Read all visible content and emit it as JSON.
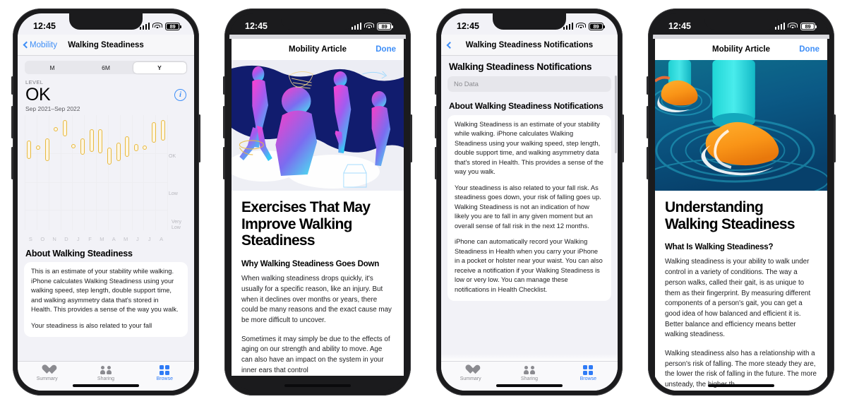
{
  "status_bar": {
    "time": "12:45",
    "battery": "89",
    "signal_icon": "cellular-bars-icon",
    "wifi_icon": "wifi-icon",
    "battery_icon": "battery-icon"
  },
  "phones": [
    {
      "id": "walking-steadiness-detail",
      "nav": {
        "back_label": "Mobility",
        "title": "Walking Steadiness"
      },
      "segmented": {
        "options": [
          "M",
          "6M",
          "Y"
        ],
        "selected": "Y"
      },
      "level_label": "LEVEL",
      "level_value": "OK",
      "info_icon": "info-circle-icon",
      "date_range": "Sep 2021–Sep 2022",
      "about_title": "About Walking Steadiness",
      "about_paragraphs": [
        "This is an estimate of your stability while walking. iPhone calculates Walking Steadiness using your walking speed, step length, double support time, and walking asymmetry data that's stored in Health. This provides a sense of the way you walk.",
        "Your steadiness is also related to your fall"
      ]
    },
    {
      "id": "exercises-article",
      "nav": {
        "title": "Mobility Article",
        "done_label": "Done"
      },
      "hero_alt": "walking-figures-illustration",
      "title": "Exercises That May Improve Walking Steadiness",
      "subhead": "Why Walking Steadiness Goes Down",
      "paragraphs": [
        "When walking steadiness drops quickly, it's usually for a specific reason, like an injury. But when it declines over months or years, there could be many reasons and the exact cause may be more difficult to uncover.",
        "Sometimes it may simply be due to the effects of aging on our strength and ability to move. Age can also have an impact on the system in your inner ears that control"
      ]
    },
    {
      "id": "notifications-settings",
      "nav": {
        "title": "Walking Steadiness Notifications"
      },
      "page_heading": "Walking Steadiness Notifications",
      "nodata_value": "No Data",
      "about_title": "About Walking Steadiness Notifications",
      "paragraphs": [
        "Walking Steadiness is an estimate of your stability while walking. iPhone calculates Walking Steadiness using your walking speed, step length, double support time, and walking asymmetry data that's stored in Health. This provides a sense of the way you walk.",
        "Your steadiness is also related to your fall risk. As steadiness goes down, your risk of falling goes up. Walking Steadiness is not an indication of how likely you are to fall in any given moment but an overall sense of fall risk in the next 12 months.",
        "iPhone can automatically record your Walking Steadiness in Health when you carry your iPhone in a pocket or holster near your waist. You can also receive a notification if your Walking Steadiness is low or very low. You can manage these notifications in Health Checklist."
      ]
    },
    {
      "id": "understanding-article",
      "nav": {
        "title": "Mobility Article",
        "done_label": "Done"
      },
      "hero_alt": "shoes-water-ripple-illustration",
      "title": "Understanding Walking Steadiness",
      "subhead": "What Is Walking Steadiness?",
      "paragraphs": [
        "Walking steadiness is your ability to walk under control in a variety of conditions. The way a person walks, called their gait, is as unique to them as their fingerprint. By measuring different components of a person's gait, you can get a good idea of how balanced and efficient it is. Better balance and efficiency means better walking steadiness.",
        "Walking steadiness also has a relationship with a person's risk of falling. The more steady they are, the lower the risk of falling in the future. The more unsteady, the higher th"
      ]
    }
  ],
  "tabbar": {
    "items": [
      {
        "label": "Summary",
        "icon": "heart-icon",
        "active": false
      },
      {
        "label": "Sharing",
        "icon": "people-icon",
        "active": false
      },
      {
        "label": "Browse",
        "icon": "grid-icon",
        "active": true
      }
    ]
  },
  "chart_data": {
    "type": "bar",
    "title": "Walking Steadiness",
    "subtitle": "Sep 2021–Sep 2022",
    "xlabel": "",
    "ylabel": "",
    "categories": [
      "S",
      "O",
      "N",
      "D",
      "J",
      "F",
      "M",
      "A",
      "M",
      "J",
      "J",
      "A"
    ],
    "tick_labels_y": [
      "OK",
      "Low",
      "Very Low"
    ],
    "ylim": [
      0,
      100
    ],
    "grid": true,
    "legend": null,
    "bar_color": "#e8b93f",
    "note": "floating range bars: each month shows min-max walking steadiness range, all in the OK band",
    "series": [
      {
        "name": "Walking Steadiness range",
        "ranges": [
          {
            "month": "S",
            "low": 62,
            "high": 78
          },
          {
            "month": "S2",
            "low": 72,
            "high": 74,
            "marker": "dot"
          },
          {
            "month": "O",
            "low": 60,
            "high": 80
          },
          {
            "month": "O2",
            "low": 88,
            "high": 90,
            "marker": "dot"
          },
          {
            "month": "N",
            "low": 82,
            "high": 96
          },
          {
            "month": "N2",
            "low": 73,
            "high": 75,
            "marker": "dot"
          },
          {
            "month": "D",
            "low": 66,
            "high": 80
          },
          {
            "month": "J",
            "low": 68,
            "high": 88
          },
          {
            "month": "F",
            "low": 67,
            "high": 88
          },
          {
            "month": "M",
            "low": 57,
            "high": 72
          },
          {
            "month": "A",
            "low": 60,
            "high": 76
          },
          {
            "month": "M2",
            "low": 64,
            "high": 82
          },
          {
            "month": "J",
            "low": 69,
            "high": 75
          },
          {
            "month": "J2",
            "low": 70,
            "high": 74,
            "marker": "dot"
          },
          {
            "month": "J3",
            "low": 76,
            "high": 94
          },
          {
            "month": "A2",
            "low": 78,
            "high": 96
          }
        ]
      }
    ]
  }
}
